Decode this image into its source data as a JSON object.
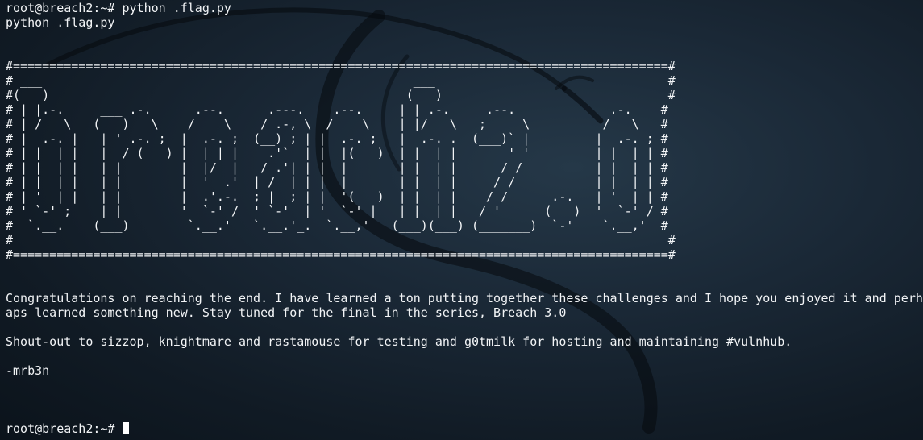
{
  "terminal": {
    "prompt": "root@breach2:~# ",
    "command": "python .flag.py",
    "echo": "python .flag.py",
    "banner": [
      "#==========================================================================================#",
      "# ___                                                   ___                                #",
      "#(   )                                                 (   )                               #",
      "# | |.-.     ___ .-.      .--.      .---.    .--.     | | .-.     .--.             .-.    #",
      "# | /   \\   (   )   \\    /    \\    / .-, \\  /    \\    | |/   \\   ;  _  \\          /   \\   #",
      "# |  .-. |   | ' .-. ;  |  .-. ;  (__) ; | |  .-. ;   |  .-. .  (___)` |         |  .-. ; #",
      "# | |  | |   |  / (___) |  | | |    .'`  | |  |(___)  | |  | |       ' '         | |  | | #",
      "# | |  | |   | |        |  |/  |   / .'| | |  |       | |  | |      / /          | |  | | #",
      "# | |  | |   | |        |  ' _.'  | /  | | |  | ___   | |  | |     / /           | |  | | #",
      "# | '  | |   | |        |  .'.-.  ; |  ; | |  '(   )  | |  | |    / /      .-.   | '  | | #",
      "# ' `-' ;    | |        '  `-' /  ' `-'  | '  `-' |   | |  | |   / '____  (   )  '  `-' / #",
      "#  `.__.    (___)        `.__.'   `.__.'_.  `.__,'   (___)(___) (_______)  `-'    `.__,'  #",
      "#                                                                                          #",
      "#==========================================================================================#"
    ],
    "message_1": "Congratulations on reaching the end. I have learned a ton putting together these challenges and I hope you enjoyed it and perhaps learned something new. Stay tuned for the final in the series, Breach 3.0",
    "message_2": "Shout-out to sizzop, knightmare and rastamouse for testing and g0tmilk for hosting and maintaining #vulnhub.",
    "signature": "-mrb3n",
    "final_prompt": "root@breach2:~# "
  },
  "colors": {
    "background": "#16222e",
    "text": "#f2f4f6",
    "cursor": "#ffffff"
  },
  "icons": {
    "wallpaper": "kali-dragon-icon"
  }
}
